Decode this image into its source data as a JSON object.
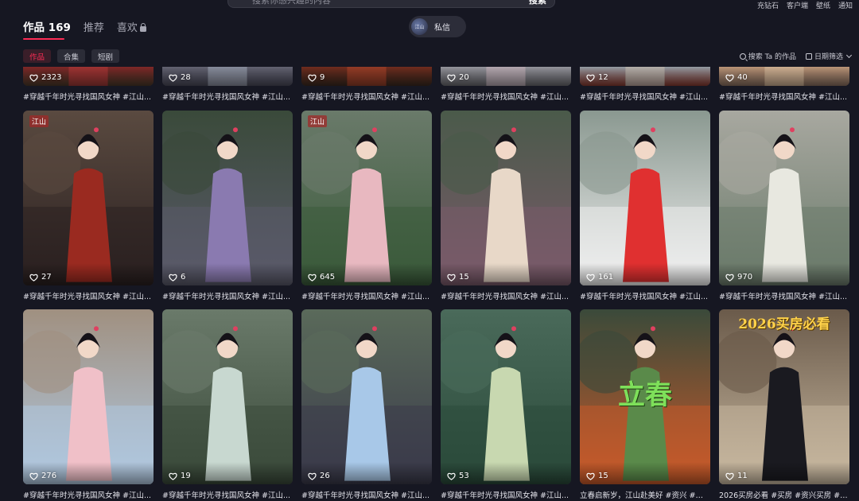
{
  "topbar": {
    "search_placeholder": "搜索你感兴趣的内容",
    "search_button": "搜索",
    "links": [
      "充钻石",
      "客户端",
      "壁纸",
      "通知"
    ]
  },
  "tabs": [
    {
      "label": "作品 169"
    },
    {
      "label": "推荐"
    },
    {
      "label": "喜欢"
    }
  ],
  "dm": {
    "label": "私信",
    "avatar_text": "江山"
  },
  "chips": [
    {
      "label": "作品"
    },
    {
      "label": "合集"
    },
    {
      "label": "短剧"
    }
  ],
  "tools": {
    "search_works": "搜索 Ta 的作品",
    "date_filter": "日期筛选"
  },
  "colors": {
    "accent": "#fe2c55",
    "background": "#161722"
  },
  "rows": [
    [
      {
        "likes": "2323",
        "title": "#穿越千年时光寻找国风女神 #江山..."
      },
      {
        "likes": "28",
        "title": "#穿越千年时光寻找国风女神 #江山..."
      },
      {
        "likes": "9",
        "title": "#穿越千年时光寻找国风女神 #江山..."
      },
      {
        "likes": "20",
        "title": "#穿越千年时光寻找国风女神 #江山..."
      },
      {
        "likes": "12",
        "title": "#穿越千年时光寻找国风女神 #江山..."
      },
      {
        "likes": "40",
        "title": "#穿越千年时光寻找国风女神 #江山..."
      }
    ],
    [
      {
        "likes": "27",
        "title": "#穿越千年时光寻找国风女神 #江山..."
      },
      {
        "likes": "6",
        "title": "#穿越千年时光寻找国风女神 #江山..."
      },
      {
        "likes": "645",
        "title": "#穿越千年时光寻找国风女神 #江山..."
      },
      {
        "likes": "15",
        "title": "#穿越千年时光寻找国风女神 #江山..."
      },
      {
        "likes": "161",
        "title": "#穿越千年时光寻找国风女神 #江山..."
      },
      {
        "likes": "970",
        "title": "#穿越千年时光寻找国风女神 #江山..."
      }
    ],
    [
      {
        "likes": "276",
        "title": "#穿越千年时光寻找国风女神 #江山..."
      },
      {
        "likes": "19",
        "title": "#穿越千年时光寻找国风女神 #江山..."
      },
      {
        "likes": "26",
        "title": "#穿越千年时光寻找国风女神 #江山..."
      },
      {
        "likes": "53",
        "title": "#穿越千年时光寻找国风女神 #江山..."
      },
      {
        "likes": "15",
        "title": "立春启新岁，江山赴美好 #资兴 #汉..."
      },
      {
        "likes": "11",
        "title": "2026买房必看 #买房 #资兴买房 #资..."
      }
    ]
  ],
  "overlays": {
    "spring": "立春",
    "house": "2026买房必看",
    "watermark": "江山"
  }
}
